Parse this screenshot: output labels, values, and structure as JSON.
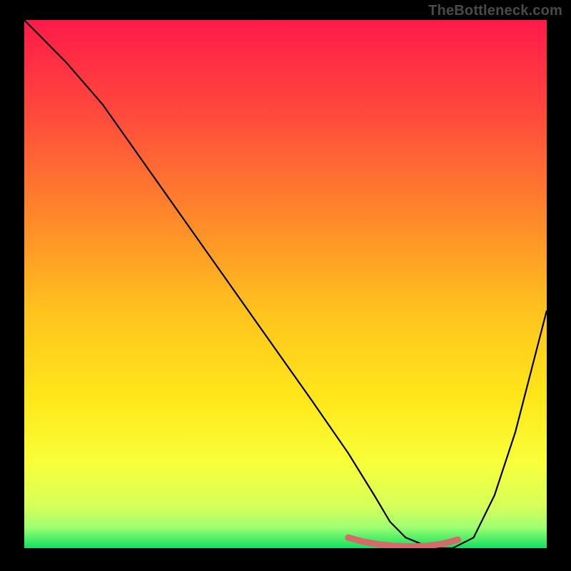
{
  "watermark": "TheBottleneck.com",
  "chart_data": {
    "type": "line",
    "title": "",
    "xlabel": "",
    "ylabel": "",
    "xlim": [
      0,
      100
    ],
    "ylim": [
      0,
      100
    ],
    "gradient_stops": [
      {
        "offset": 0,
        "color": "#ff1a4a"
      },
      {
        "offset": 18,
        "color": "#ff4a3c"
      },
      {
        "offset": 38,
        "color": "#ff8a2a"
      },
      {
        "offset": 55,
        "color": "#ffc21e"
      },
      {
        "offset": 72,
        "color": "#ffe81a"
      },
      {
        "offset": 84,
        "color": "#f8ff3a"
      },
      {
        "offset": 92,
        "color": "#d6ff5a"
      },
      {
        "offset": 96,
        "color": "#a0ff70"
      },
      {
        "offset": 100,
        "color": "#10e060"
      }
    ],
    "series": [
      {
        "name": "bottleneck-curve",
        "color": "#000000",
        "x": [
          0,
          3,
          8,
          15,
          25,
          35,
          45,
          55,
          62,
          67,
          70,
          73,
          78,
          82,
          86,
          90,
          94,
          100
        ],
        "y": [
          100,
          97,
          92,
          84,
          70,
          56,
          42,
          28,
          18,
          10,
          5,
          2,
          0,
          0,
          2,
          10,
          22,
          45
        ]
      }
    ],
    "highlight": {
      "name": "optimal-range",
      "color": "#d46a6a",
      "x": [
        62,
        65,
        68,
        71,
        74,
        77,
        80,
        83
      ],
      "y": [
        2,
        1.2,
        0.7,
        0.4,
        0.3,
        0.4,
        0.8,
        1.6
      ]
    }
  }
}
